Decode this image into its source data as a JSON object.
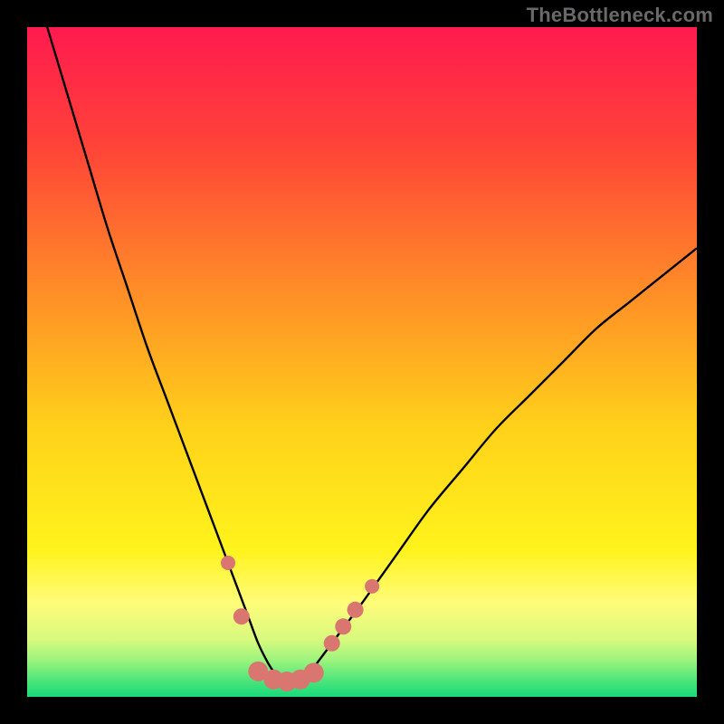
{
  "watermark": "TheBottleneck.com",
  "chart_data": {
    "type": "line",
    "title": "",
    "xlabel": "",
    "ylabel": "",
    "xlim": [
      0,
      100
    ],
    "ylim": [
      0,
      100
    ],
    "grid": false,
    "legend": false,
    "background": {
      "type": "vertical-gradient",
      "stops": [
        {
          "pos": 0.0,
          "color": "#ff1a4f"
        },
        {
          "pos": 0.18,
          "color": "#ff4438"
        },
        {
          "pos": 0.4,
          "color": "#ff8f27"
        },
        {
          "pos": 0.6,
          "color": "#ffd21a"
        },
        {
          "pos": 0.78,
          "color": "#fff31c"
        },
        {
          "pos": 0.86,
          "color": "#fffc7a"
        },
        {
          "pos": 0.915,
          "color": "#d7f97e"
        },
        {
          "pos": 0.945,
          "color": "#9cf47d"
        },
        {
          "pos": 0.975,
          "color": "#4ee57b"
        },
        {
          "pos": 1.0,
          "color": "#18da79"
        }
      ]
    },
    "series": [
      {
        "name": "bottleneck-curve",
        "color": "#000000",
        "x": [
          3,
          6,
          9,
          12,
          15,
          18,
          21,
          24,
          27,
          30,
          31.5,
          33,
          34.5,
          36,
          37,
          38,
          39,
          40,
          42,
          44,
          47,
          50,
          55,
          60,
          65,
          70,
          75,
          80,
          85,
          90,
          95,
          100
        ],
        "y": [
          100,
          90,
          80,
          70,
          61,
          52,
          44,
          36,
          28,
          20,
          16,
          12,
          8,
          5,
          3.5,
          2.5,
          2.2,
          2.5,
          3.5,
          6,
          10,
          14,
          21,
          28,
          34,
          40,
          45,
          50,
          55,
          59,
          63,
          67
        ]
      }
    ],
    "markers": [
      {
        "name": "marker-left-upper",
        "x": 30.0,
        "y": 20.0,
        "r": 8,
        "color": "#da7670"
      },
      {
        "name": "marker-left-edge",
        "x": 32.0,
        "y": 12.0,
        "r": 9,
        "color": "#da7670"
      },
      {
        "name": "marker-bottom-1",
        "x": 34.5,
        "y": 3.8,
        "r": 11,
        "color": "#da7670"
      },
      {
        "name": "marker-bottom-2",
        "x": 36.8,
        "y": 2.6,
        "r": 11,
        "color": "#da7670"
      },
      {
        "name": "marker-bottom-3",
        "x": 38.8,
        "y": 2.3,
        "r": 11,
        "color": "#da7670"
      },
      {
        "name": "marker-bottom-4",
        "x": 40.8,
        "y": 2.6,
        "r": 11,
        "color": "#da7670"
      },
      {
        "name": "marker-bottom-5",
        "x": 42.8,
        "y": 3.6,
        "r": 11,
        "color": "#da7670"
      },
      {
        "name": "marker-right-1",
        "x": 45.5,
        "y": 8.0,
        "r": 9,
        "color": "#da7670"
      },
      {
        "name": "marker-right-2",
        "x": 47.2,
        "y": 10.5,
        "r": 9,
        "color": "#da7670"
      },
      {
        "name": "marker-right-3",
        "x": 49.0,
        "y": 13.0,
        "r": 9,
        "color": "#da7670"
      },
      {
        "name": "marker-right-upper",
        "x": 51.5,
        "y": 16.5,
        "r": 8,
        "color": "#da7670"
      }
    ]
  }
}
